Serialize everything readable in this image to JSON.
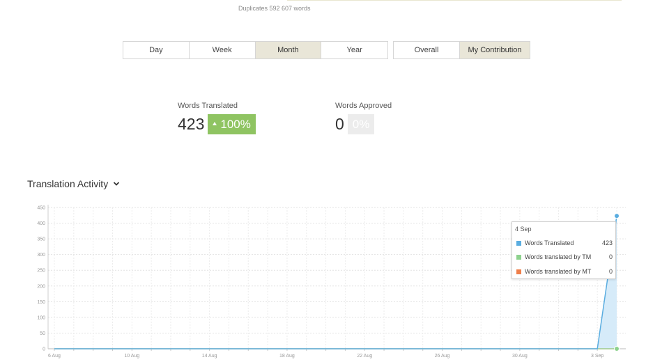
{
  "header": {
    "duplicates_text": "Duplicates 592 607 words"
  },
  "period_tabs": [
    {
      "label": "Day",
      "active": false
    },
    {
      "label": "Week",
      "active": false
    },
    {
      "label": "Month",
      "active": true
    },
    {
      "label": "Year",
      "active": false
    }
  ],
  "scope_tabs": [
    {
      "label": "Overall",
      "active": false
    },
    {
      "label": "My Contribution",
      "active": true
    }
  ],
  "stats": {
    "translated": {
      "label": "Words Translated",
      "value": "423",
      "change": "100%"
    },
    "approved": {
      "label": "Words Approved",
      "value": "0",
      "change": "0%"
    }
  },
  "activity": {
    "title": "Translation Activity",
    "toggle_icon": "chevron-down-icon"
  },
  "colors": {
    "translated": "#5aade0",
    "tm": "#8ed28e",
    "mt": "#ef7f4a",
    "badge_green": "#8fc462"
  },
  "chart_data": {
    "type": "line",
    "x": [
      "6 Aug",
      "7 Aug",
      "8 Aug",
      "9 Aug",
      "10 Aug",
      "11 Aug",
      "12 Aug",
      "13 Aug",
      "14 Aug",
      "15 Aug",
      "16 Aug",
      "17 Aug",
      "18 Aug",
      "19 Aug",
      "20 Aug",
      "21 Aug",
      "22 Aug",
      "23 Aug",
      "24 Aug",
      "25 Aug",
      "26 Aug",
      "27 Aug",
      "28 Aug",
      "29 Aug",
      "30 Aug",
      "31 Aug",
      "1 Sep",
      "2 Sep",
      "3 Sep",
      "4 Sep"
    ],
    "x_tick_labels": [
      "6 Aug",
      "10 Aug",
      "14 Aug",
      "18 Aug",
      "22 Aug",
      "26 Aug",
      "30 Aug",
      "3 Sep"
    ],
    "y_ticks": [
      0,
      50,
      100,
      150,
      200,
      250,
      300,
      350,
      400,
      450
    ],
    "ylim": [
      0,
      450
    ],
    "grid": true,
    "series": [
      {
        "name": "Words Translated",
        "values": [
          0,
          0,
          0,
          0,
          0,
          0,
          0,
          0,
          0,
          0,
          0,
          0,
          0,
          0,
          0,
          0,
          0,
          0,
          0,
          0,
          0,
          0,
          0,
          0,
          0,
          0,
          0,
          0,
          0,
          423
        ]
      },
      {
        "name": "Words translated by TM",
        "values": [
          0,
          0,
          0,
          0,
          0,
          0,
          0,
          0,
          0,
          0,
          0,
          0,
          0,
          0,
          0,
          0,
          0,
          0,
          0,
          0,
          0,
          0,
          0,
          0,
          0,
          0,
          0,
          0,
          0,
          0
        ]
      },
      {
        "name": "Words translated by MT",
        "values": [
          0,
          0,
          0,
          0,
          0,
          0,
          0,
          0,
          0,
          0,
          0,
          0,
          0,
          0,
          0,
          0,
          0,
          0,
          0,
          0,
          0,
          0,
          0,
          0,
          0,
          0,
          0,
          0,
          0,
          0
        ]
      }
    ],
    "tooltip": {
      "date": "4 Sep",
      "rows": [
        {
          "name": "Words Translated",
          "value": "423"
        },
        {
          "name": "Words translated by TM",
          "value": "0"
        },
        {
          "name": "Words translated by MT",
          "value": "0"
        }
      ]
    }
  }
}
